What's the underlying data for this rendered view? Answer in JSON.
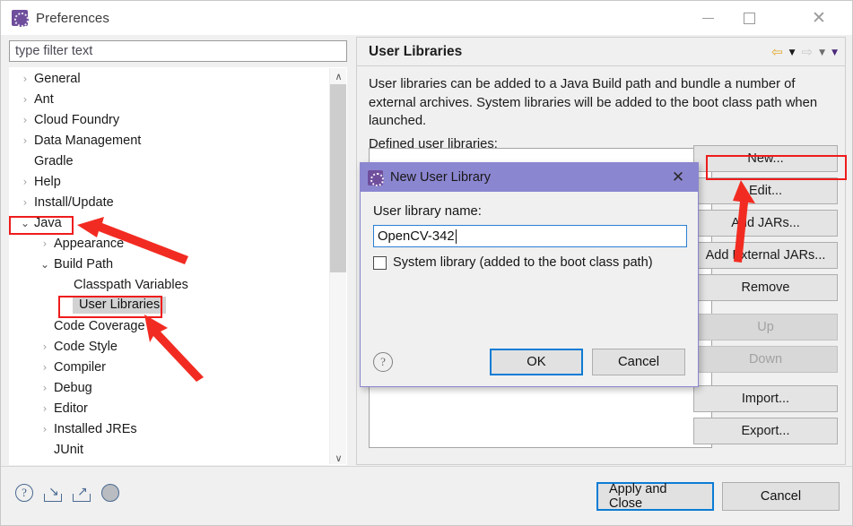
{
  "window": {
    "title": "Preferences",
    "icon": "eclipse-preferences-icon",
    "minimize_label": "Minimize",
    "maximize_label": "Maximize",
    "close_label": "Close",
    "close_glyph": "✕"
  },
  "filter": {
    "name": "type filter text",
    "placeholder": "type filter text",
    "value": ""
  },
  "tree": {
    "items": [
      {
        "label": "General",
        "level": 0,
        "twisty": "collapsed",
        "selected": false
      },
      {
        "label": "Ant",
        "level": 0,
        "twisty": "collapsed",
        "selected": false
      },
      {
        "label": "Cloud Foundry",
        "level": 0,
        "twisty": "collapsed",
        "selected": false
      },
      {
        "label": "Data Management",
        "level": 0,
        "twisty": "collapsed",
        "selected": false
      },
      {
        "label": "Gradle",
        "level": 0,
        "twisty": "none",
        "selected": false
      },
      {
        "label": "Help",
        "level": 0,
        "twisty": "collapsed",
        "selected": false
      },
      {
        "label": "Install/Update",
        "level": 0,
        "twisty": "collapsed",
        "selected": false
      },
      {
        "label": "Java",
        "level": 0,
        "twisty": "expanded",
        "selected": false
      },
      {
        "label": "Appearance",
        "level": 1,
        "twisty": "collapsed",
        "selected": false
      },
      {
        "label": "Build Path",
        "level": 1,
        "twisty": "expanded",
        "selected": false
      },
      {
        "label": "Classpath Variables",
        "level": 2,
        "twisty": "none",
        "selected": false
      },
      {
        "label": "User Libraries",
        "level": 2,
        "twisty": "none",
        "selected": true
      },
      {
        "label": "Code Coverage",
        "level": 1,
        "twisty": "none",
        "selected": false
      },
      {
        "label": "Code Style",
        "level": 1,
        "twisty": "collapsed",
        "selected": false
      },
      {
        "label": "Compiler",
        "level": 1,
        "twisty": "collapsed",
        "selected": false
      },
      {
        "label": "Debug",
        "level": 1,
        "twisty": "collapsed",
        "selected": false
      },
      {
        "label": "Editor",
        "level": 1,
        "twisty": "collapsed",
        "selected": false
      },
      {
        "label": "Installed JREs",
        "level": 1,
        "twisty": "collapsed",
        "selected": false
      },
      {
        "label": "JUnit",
        "level": 1,
        "twisty": "none",
        "selected": false
      }
    ],
    "twisty_collapsed_glyph": "›",
    "twisty_expanded_glyph": "⌄",
    "scrollbar": {
      "up_glyph": "∧",
      "down_glyph": "∨"
    }
  },
  "right_pane": {
    "title": "User Libraries",
    "nav": {
      "back_glyph": "⇦",
      "back_caret": "▼",
      "forward_glyph": "⇨",
      "forward_caret": "▼",
      "menu_caret": "▼"
    },
    "description": "User libraries can be added to a Java Build path and bundle a number of external archives. System libraries will be added to the boot class path when launched.",
    "defined_label": "Defined user libraries:",
    "buttons": [
      {
        "label": "New...",
        "enabled": true,
        "gap": false
      },
      {
        "label": "Edit...",
        "enabled": true,
        "gap": false
      },
      {
        "label": "Add JARs...",
        "enabled": true,
        "gap": false
      },
      {
        "label": "Add External JARs...",
        "enabled": true,
        "gap": false
      },
      {
        "label": "Remove",
        "enabled": true,
        "gap": false
      },
      {
        "label": "Up",
        "enabled": false,
        "gap": true
      },
      {
        "label": "Down",
        "enabled": false,
        "gap": false
      },
      {
        "label": "Import...",
        "enabled": true,
        "gap": true
      },
      {
        "label": "Export...",
        "enabled": true,
        "gap": false
      }
    ]
  },
  "modal": {
    "title": "New User Library",
    "icon": "eclipse-preferences-icon",
    "close_glyph": "✕",
    "field_label": "User library name:",
    "field_value": "OpenCV-342",
    "checkbox_label": "System library (added to the boot class path)",
    "checkbox_checked": false,
    "help_glyph": "?",
    "ok_label": "OK",
    "cancel_label": "Cancel"
  },
  "bottom": {
    "icons": [
      {
        "name": "help-icon",
        "glyph": "?"
      },
      {
        "name": "import-icon",
        "glyph": "↘"
      },
      {
        "name": "export-icon",
        "glyph": "↗"
      },
      {
        "name": "restore-defaults-icon",
        "glyph": ""
      }
    ],
    "apply_and_close_label": "Apply and Close",
    "cancel_label": "Cancel"
  },
  "annotations": {
    "color": "#ee1c1c",
    "highlights": [
      {
        "target": "Java"
      },
      {
        "target": "User Libraries"
      },
      {
        "target": "New..."
      }
    ]
  }
}
